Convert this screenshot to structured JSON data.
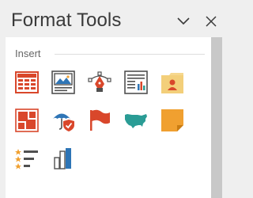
{
  "pane": {
    "title": "Format Tools",
    "collapse_icon": "chevron-down-icon",
    "close_icon": "close-icon"
  },
  "insert": {
    "label": "Insert",
    "tools": [
      {
        "icon": "table-icon"
      },
      {
        "icon": "picture-caption-icon"
      },
      {
        "icon": "pen-tool-icon"
      },
      {
        "icon": "text-chart-report-icon"
      },
      {
        "icon": "contact-card-icon"
      },
      {
        "icon": "tile-grid-icon"
      },
      {
        "icon": "umbrella-shield-icon"
      },
      {
        "icon": "flag-icon"
      },
      {
        "icon": "us-map-icon"
      },
      {
        "icon": "sticky-note-icon"
      },
      {
        "icon": "rating-list-icon"
      },
      {
        "icon": "bar-chart-icon"
      }
    ]
  },
  "colors": {
    "accent_red": "#d9472b",
    "accent_blue": "#2e75b6",
    "accent_teal": "#2a9c95",
    "accent_orange": "#f0a030",
    "icon_gray": "#505050"
  }
}
